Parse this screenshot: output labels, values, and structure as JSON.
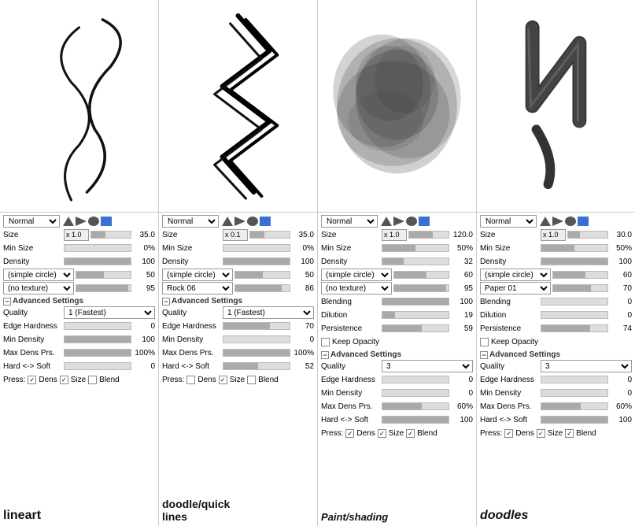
{
  "panels": [
    {
      "id": "lineart",
      "name": "lineart",
      "blendMode": "Normal",
      "size": {
        "multiplier": "x 1.0",
        "value": "35.0"
      },
      "minSize": "0%",
      "density": "100",
      "brush1": "(simple circle)",
      "brush1Val": "50",
      "brush2": "(no texture)",
      "brush2Val": "95",
      "blending": null,
      "dilution": null,
      "persistence": null,
      "keepOpacity": false,
      "quality": "1 (Fastest)",
      "edgeHardness": "0",
      "minDensity": "100",
      "maxDensPrs": "100%",
      "hardSoft": "0",
      "pressLine": "Dens Size",
      "pressBlend": false,
      "sliders": {
        "density": 100,
        "edgeHardness": 0,
        "minDensity": 100,
        "hardSoft": 0
      }
    },
    {
      "id": "doodle",
      "name": "doodle/quick\nlines",
      "blendMode": "Normal",
      "size": {
        "multiplier": "x 0.1",
        "value": "35.0"
      },
      "minSize": "0%",
      "density": "100",
      "brush1": "(simple circle)",
      "brush1Val": "50",
      "brush2": "Rock 06",
      "brush2Val": "86",
      "blending": null,
      "dilution": null,
      "persistence": null,
      "keepOpacity": false,
      "quality": "1 (Fastest)",
      "edgeHardness": "70",
      "minDensity": "0",
      "maxDensPrs": "100%",
      "hardSoft": "52",
      "pressLine": "Dens Size",
      "pressBlend": false,
      "sliders": {
        "density": 100,
        "edgeHardness": 70,
        "minDensity": 0,
        "hardSoft": 52
      }
    },
    {
      "id": "paintshading",
      "name": "Paint/shading",
      "blendMode": "Normal",
      "size": {
        "multiplier": "x 1.0",
        "value": "120.0"
      },
      "minSize": "50%",
      "density": "32",
      "brush1": "(simple circle)",
      "brush1Val": "60",
      "brush2": "(no texture)",
      "brush2Val": "95",
      "blending": "100",
      "dilution": "19",
      "persistence": "59",
      "keepOpacity": false,
      "quality": "3",
      "edgeHardness": "0",
      "minDensity": "0",
      "maxDensPrs": "60%",
      "hardSoft": "100",
      "pressLine": "Dens Size Blend",
      "pressBlend": true,
      "sliders": {
        "density": 32,
        "blending": 100,
        "dilution": 19,
        "persistence": 59,
        "edgeHardness": 0,
        "minDensity": 0,
        "hardSoft": 100
      }
    },
    {
      "id": "doodles",
      "name": "doodles",
      "blendMode": "Normal",
      "size": {
        "multiplier": "x 1.0",
        "value": "30.0"
      },
      "minSize": "50%",
      "density": "100",
      "brush1": "(simple circle)",
      "brush1Val": "60",
      "brush2": "Paper 01",
      "brush2Val": "70",
      "blending": "0",
      "dilution": "0",
      "persistence": "74",
      "keepOpacity": false,
      "quality": "3",
      "edgeHardness": "0",
      "minDensity": "0",
      "maxDensPrs": "60%",
      "hardSoft": "100",
      "pressLine": "Dens Size Blend",
      "pressBlend": true,
      "sliders": {
        "density": 100,
        "blending": 0,
        "dilution": 0,
        "persistence": 74,
        "edgeHardness": 0,
        "minDensity": 0,
        "hardSoft": 100
      }
    }
  ]
}
